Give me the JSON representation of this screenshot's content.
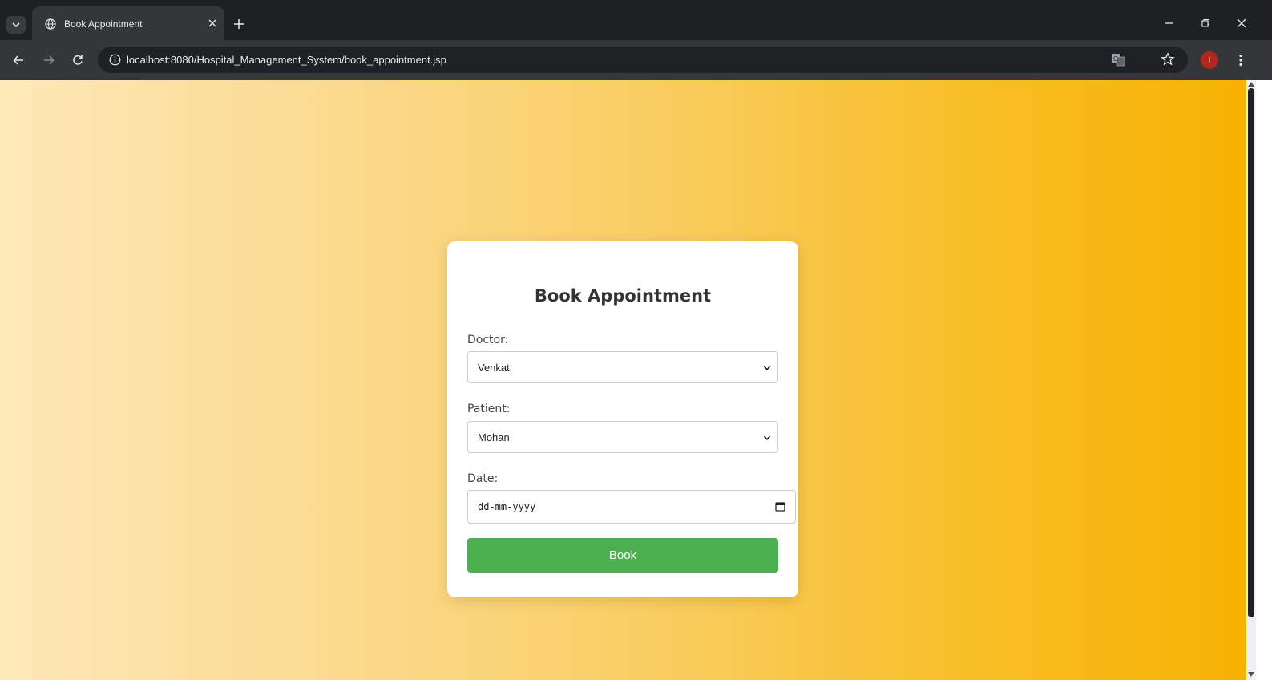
{
  "browser": {
    "tab": {
      "title": "Book Appointment",
      "favicon": "globe-icon"
    },
    "url": "localhost:8080/Hospital_Management_System/book_appointment.jsp",
    "profile_initial": "I",
    "colors": {
      "tabstrip": "#1f2022",
      "toolbar": "#35363a",
      "omnibox": "#202124"
    }
  },
  "page": {
    "background_gradient": [
      "#fde8b8",
      "#f7b203"
    ],
    "form": {
      "title": "Book Appointment",
      "doctor": {
        "label": "Doctor:",
        "selected": "Venkat"
      },
      "patient": {
        "label": "Patient:",
        "selected": "Mohan"
      },
      "date": {
        "label": "Date:",
        "placeholder": "dd-mm-yyyy"
      },
      "submit_label": "Book",
      "button_color": "#4caf50"
    }
  }
}
